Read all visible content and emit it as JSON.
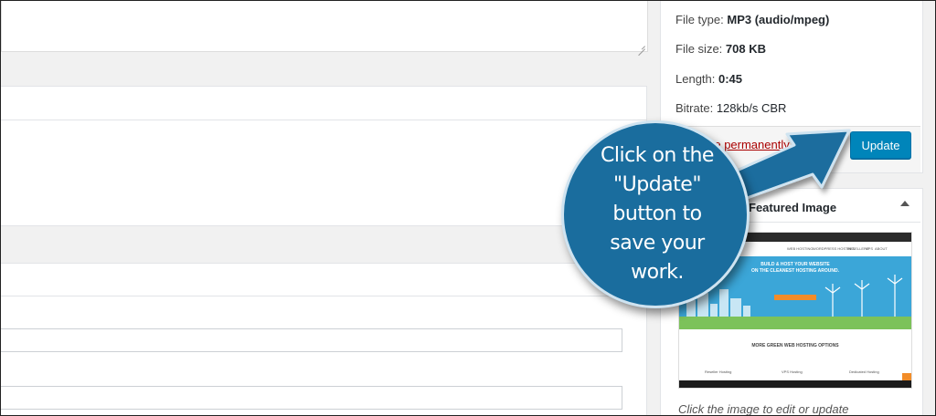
{
  "file_info": {
    "type_label": "File type:",
    "type_value": "MP3 (audio/mpeg)",
    "size_label": "File size:",
    "size_value": "708 KB",
    "length_label": "Length:",
    "length_value": "0:45",
    "bitrate_label": "Bitrate:",
    "bitrate_value": "128kb/s CBR"
  },
  "actions": {
    "delete_label": "Delete permanently",
    "update_label": "Update"
  },
  "featured_image": {
    "title": "Featured Image",
    "caption": "Click the image to edit or update",
    "thumbnail": {
      "hero_line1": "BUILD & HOST YOUR WEBSITE",
      "hero_line2": "ON THE CLEANEST HOSTING AROUND.",
      "section_title": "MORE GREEN WEB HOSTING OPTIONS",
      "col1": "Reseller Hosting",
      "col2": "VPS Hosting",
      "col3": "Dedicated Hosting",
      "nav1": "WEB HOSTING",
      "nav2": "WORDPRESS HOSTING",
      "nav3": "RESELLERS",
      "nav4": "VPS",
      "nav5": "ABOUT"
    }
  },
  "callout": {
    "text_line1": "Click on the",
    "text_line2": "\"Update\"",
    "text_line3": "button to",
    "text_line4": "save your",
    "text_line5": "work."
  },
  "colors": {
    "callout_fill": "#1a6d9e",
    "update_button": "#0085ba",
    "delete_link": "#a00000"
  }
}
